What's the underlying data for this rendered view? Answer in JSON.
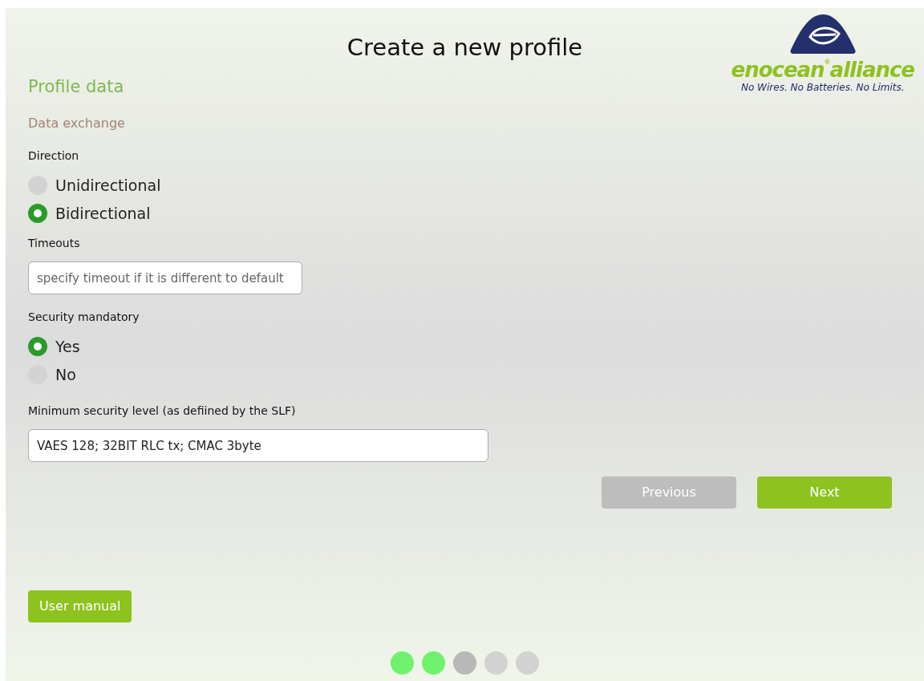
{
  "title": "Create a new profile",
  "logo": {
    "wordmark_left": "enocean",
    "registered": "®",
    "wordmark_right": "alliance",
    "tagline": "No Wires. No Batteries. No Limits."
  },
  "section": "Profile data",
  "subsection": "Data exchange",
  "fields": [
    {
      "kind": "radio",
      "label": "Direction",
      "options": [
        {
          "label": "Unidirectional",
          "selected": false
        },
        {
          "label": "Bidirectional",
          "selected": true
        }
      ]
    },
    {
      "kind": "text",
      "label": "Timeouts",
      "placeholder": "specify timeout if it is different to default"
    },
    {
      "kind": "radio",
      "label": "Security mandatory",
      "options": [
        {
          "label": "Yes",
          "selected": true
        },
        {
          "label": "No",
          "selected": false
        }
      ]
    },
    {
      "kind": "text",
      "label": "Minimum security level (as defiined by the SLF)",
      "value": "VAES 128; 32BIT RLC tx; CMAC 3byte"
    }
  ],
  "buttons": [
    {
      "label": "Previous",
      "disabled": true
    },
    {
      "label": "Next",
      "disabled": false
    }
  ],
  "manual_button": "User manual",
  "steps": [
    {
      "kind": "done"
    },
    {
      "kind": "done"
    },
    {
      "kind": "current"
    },
    {
      "kind": "todo"
    },
    {
      "kind": "todo"
    }
  ]
}
